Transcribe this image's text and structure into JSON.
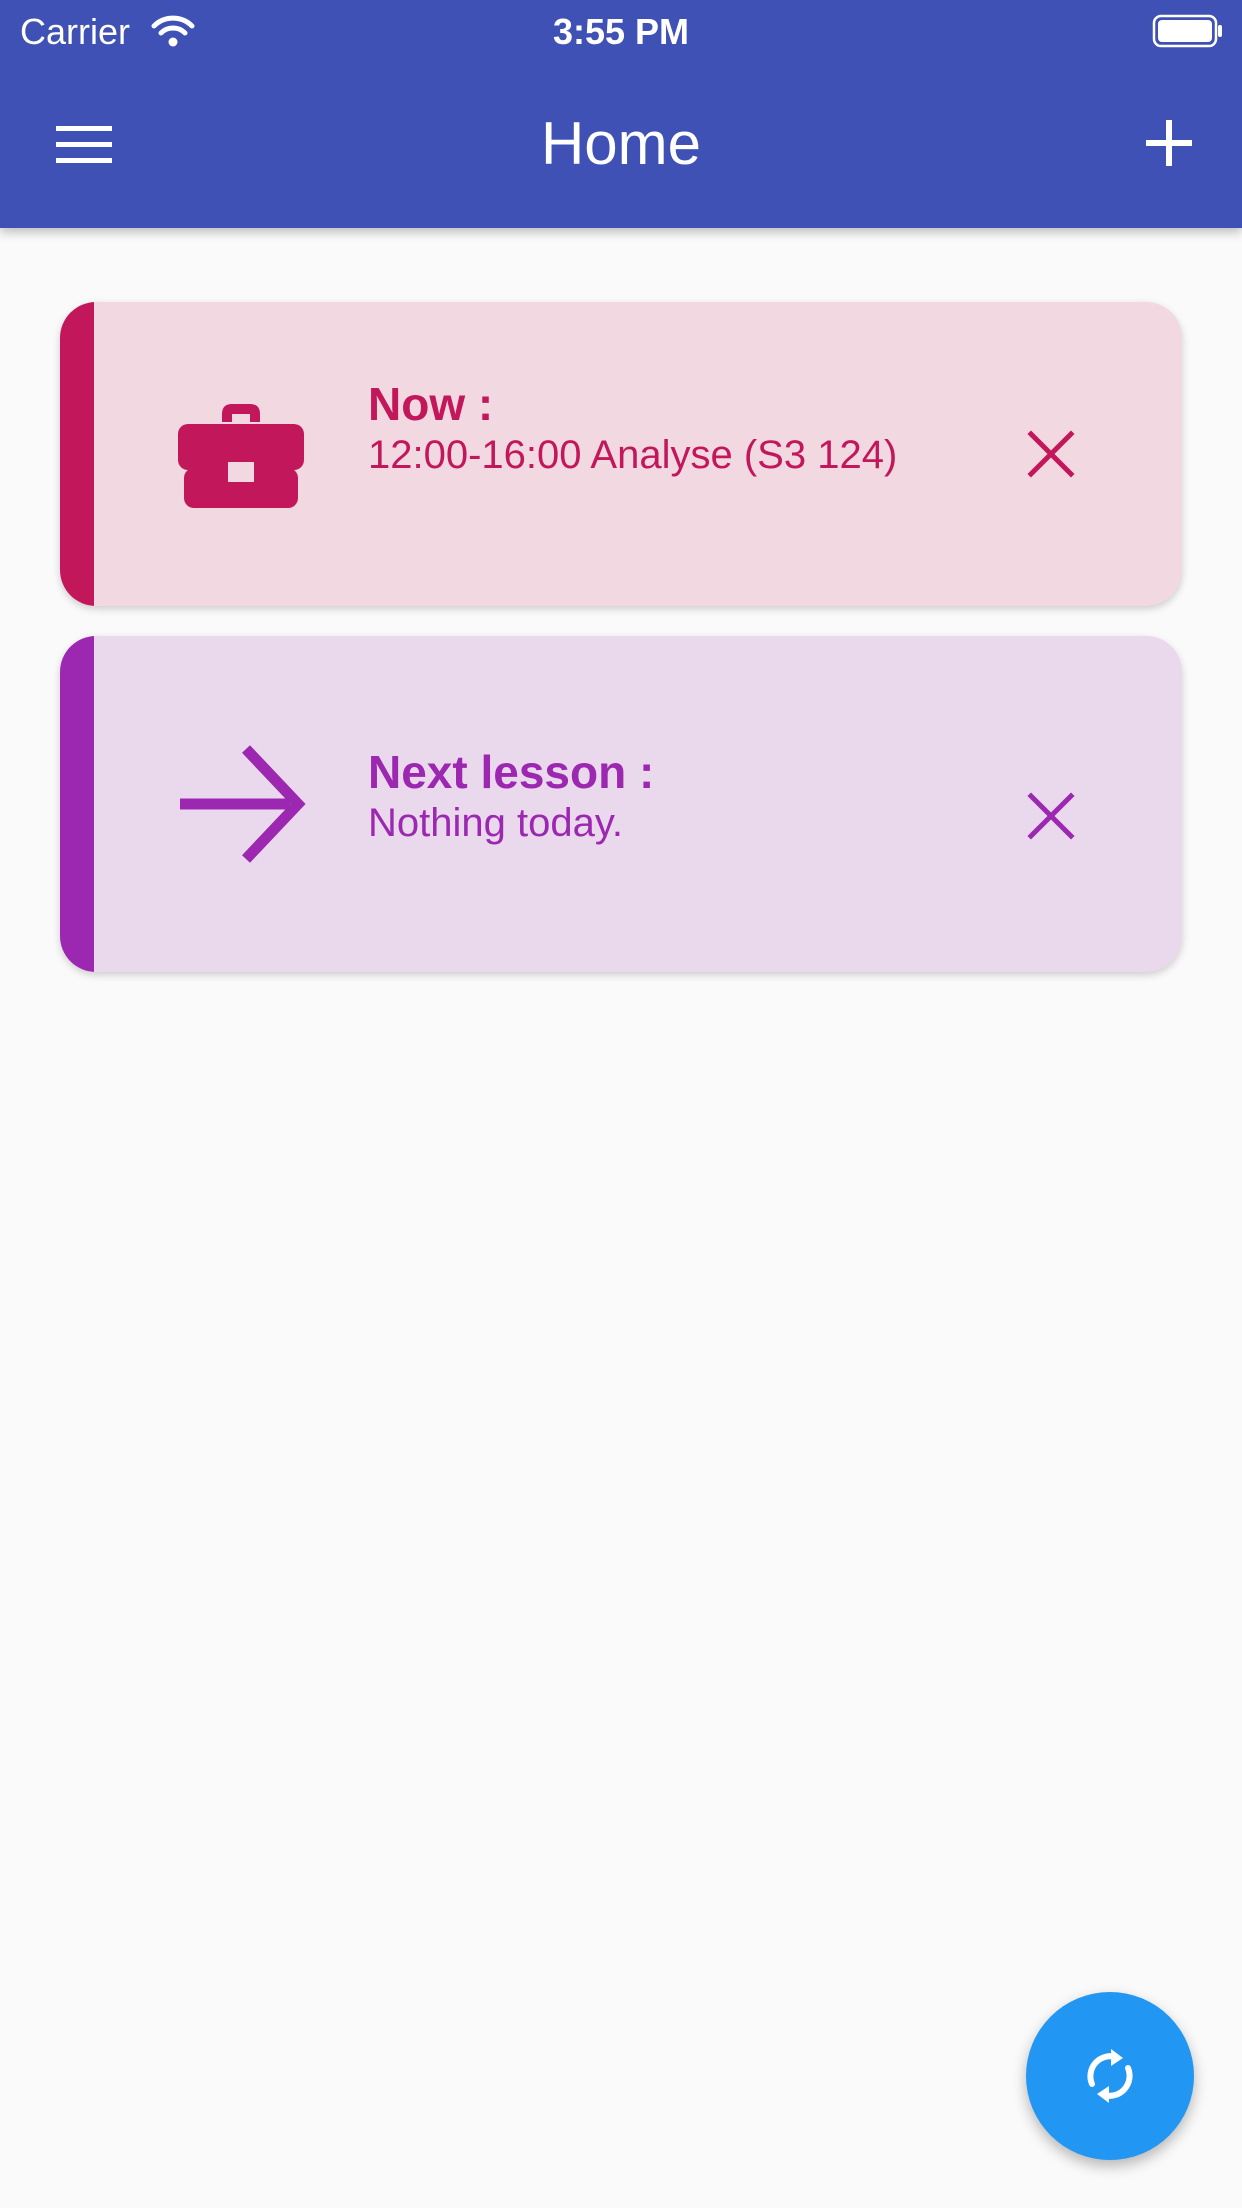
{
  "status_bar": {
    "carrier": "Carrier",
    "time": "3:55 PM",
    "wifi_icon": "wifi-icon",
    "battery_icon": "battery-icon"
  },
  "app_bar": {
    "title": "Home",
    "menu_icon": "hamburger-menu-icon",
    "add_icon": "plus-icon",
    "background_color": "#3f51b5"
  },
  "cards": [
    {
      "heading": "Now :",
      "body": "12:00-16:00 Analyse (S3 124)",
      "icon": "briefcase-icon",
      "close_icon": "close-icon",
      "accent_color": "#c2185b",
      "background_color": "#f2d8e1"
    },
    {
      "heading": "Next lesson :",
      "body": "Nothing today.",
      "icon": "arrow-right-icon",
      "close_icon": "close-icon",
      "accent_color": "#9c27b0",
      "background_color": "#ead9ec"
    }
  ],
  "fab": {
    "icon": "sync-icon",
    "color": "#2196f3"
  }
}
